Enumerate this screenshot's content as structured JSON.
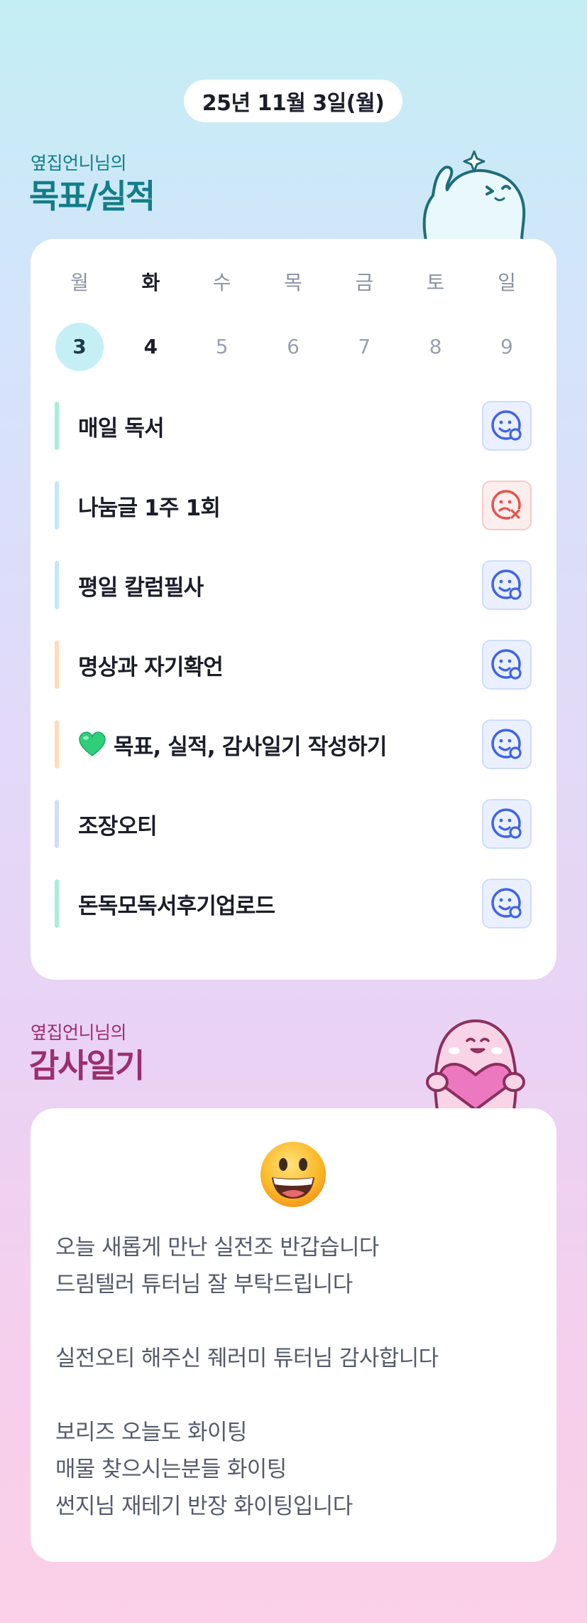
{
  "header": {
    "date": "25년 11월 3일(월)"
  },
  "goals_section": {
    "subtitle": "옆집언니님의",
    "title": "목표/실적",
    "days": [
      {
        "name": "월",
        "num": "3",
        "state": "today"
      },
      {
        "name": "화",
        "num": "4",
        "state": "active"
      },
      {
        "name": "수",
        "num": "5",
        "state": "inactive"
      },
      {
        "name": "목",
        "num": "6",
        "state": "inactive"
      },
      {
        "name": "금",
        "num": "7",
        "state": "inactive"
      },
      {
        "name": "토",
        "num": "8",
        "state": "inactive"
      },
      {
        "name": "일",
        "num": "9",
        "state": "inactive"
      }
    ],
    "goals": [
      {
        "label": "매일 독서",
        "bar_color": "#a6eed8",
        "status": "done",
        "icon": "smile-check-icon"
      },
      {
        "label": "나눔글 1주 1회",
        "bar_color": "#bfe8fb",
        "status": "failed",
        "icon": "sad-x-icon"
      },
      {
        "label": "평일 칼럼필사",
        "bar_color": "#bfe8fb",
        "status": "done",
        "icon": "smile-check-icon"
      },
      {
        "label": "명상과 자기확언",
        "bar_color": "#ffdcb8",
        "status": "done",
        "icon": "smile-check-icon"
      },
      {
        "label": "목표, 실적, 감사일기 작성하기",
        "bar_color": "#ffdcb8",
        "status": "done",
        "icon": "smile-check-icon",
        "prefix_icon": "green-heart-icon"
      },
      {
        "label": "조장오티",
        "bar_color": "#d3dbfa",
        "status": "done",
        "icon": "smile-check-icon"
      },
      {
        "label": "돈독모독서후기업로드",
        "bar_color": "#a6eed8",
        "status": "done",
        "icon": "smile-check-icon"
      }
    ]
  },
  "gratitude_section": {
    "subtitle": "옆집언니님의",
    "title": "감사일기",
    "emoji": "grinning-face-icon",
    "lines": [
      "오늘 새롭게 만난 실전조 반갑습니다",
      "드림텔러 튜터님 잘 부탁드립니다",
      "",
      "실전오티 해주신 줴러미 튜터님 감사합니다",
      "",
      "보리즈 오늘도 화이팅",
      "매물 찾으시는분들 화이팅",
      "썬지님 재테기 반장 화이팅입니다"
    ]
  },
  "colors": {
    "teal_title": "#127e87",
    "plum_title": "#9b2f6c",
    "done_blue": "#3f63e8",
    "fail_red": "#e5534b",
    "today_circle": "#c6eff5"
  }
}
